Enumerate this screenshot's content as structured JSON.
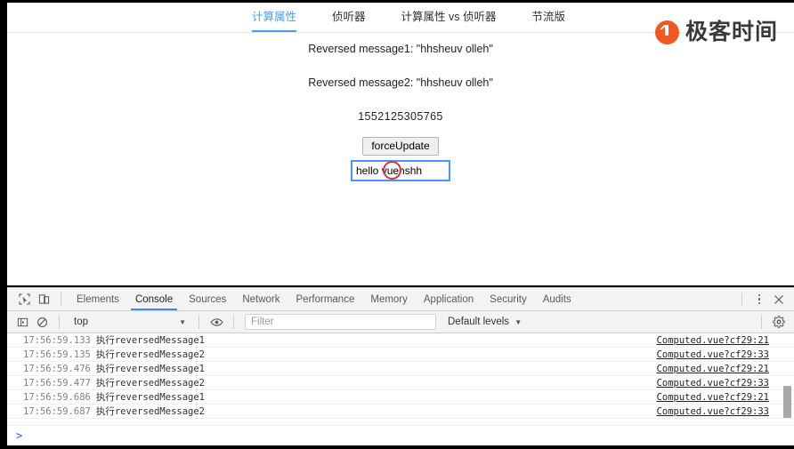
{
  "page": {
    "tabs": [
      {
        "label": "计算属性",
        "active": true
      },
      {
        "label": "侦听器",
        "active": false
      },
      {
        "label": "计算属性 vs 侦听器",
        "active": false
      },
      {
        "label": "节流版",
        "active": false
      }
    ],
    "brand": {
      "name": "极客时间",
      "color": "#f05a22"
    },
    "content": {
      "reversed1": "Reversed message1: \"hhsheuv olleh\"",
      "reversed2": "Reversed message2: \"hhsheuv olleh\"",
      "timestamp_number": "1552125305765",
      "force_update_label": "forceUpdate",
      "input_value": "hello vuehshh",
      "input_placeholder": ""
    }
  },
  "devtools": {
    "toolbar": {
      "inspect_icon": "inspect-cursor-icon",
      "device_icon": "device-toolbar-icon",
      "tabs": [
        {
          "label": "Elements",
          "active": false
        },
        {
          "label": "Console",
          "active": true
        },
        {
          "label": "Sources",
          "active": false
        },
        {
          "label": "Network",
          "active": false
        },
        {
          "label": "Performance",
          "active": false
        },
        {
          "label": "Memory",
          "active": false
        },
        {
          "label": "Application",
          "active": false
        },
        {
          "label": "Security",
          "active": false
        },
        {
          "label": "Audits",
          "active": false
        }
      ],
      "more_icon": "kebab-menu-icon",
      "close_icon": "close-icon"
    },
    "filterbar": {
      "sidebar_icon": "console-sidebar-icon",
      "clear_icon": "clear-console-icon",
      "context": "top",
      "eye_icon": "live-expression-icon",
      "filter_value": "",
      "filter_placeholder": "Filter",
      "levels": "Default levels",
      "settings_icon": "gear-icon"
    },
    "console": {
      "columns": [
        "time",
        "message",
        "source"
      ],
      "rows": [
        {
          "time": "17:56:59.133",
          "message": "执行reversedMessage1",
          "source": "Computed.vue?cf29:21"
        },
        {
          "time": "17:56:59.135",
          "message": "执行reversedMessage2",
          "source": "Computed.vue?cf29:33"
        },
        {
          "time": "17:56:59.476",
          "message": "执行reversedMessage1",
          "source": "Computed.vue?cf29:21"
        },
        {
          "time": "17:56:59.477",
          "message": "执行reversedMessage2",
          "source": "Computed.vue?cf29:33"
        },
        {
          "time": "17:56:59.686",
          "message": "执行reversedMessage1",
          "source": "Computed.vue?cf29:21"
        },
        {
          "time": "17:56:59.687",
          "message": "执行reversedMessage2",
          "source": "Computed.vue?cf29:33"
        }
      ],
      "prompt_caret": ">"
    }
  }
}
